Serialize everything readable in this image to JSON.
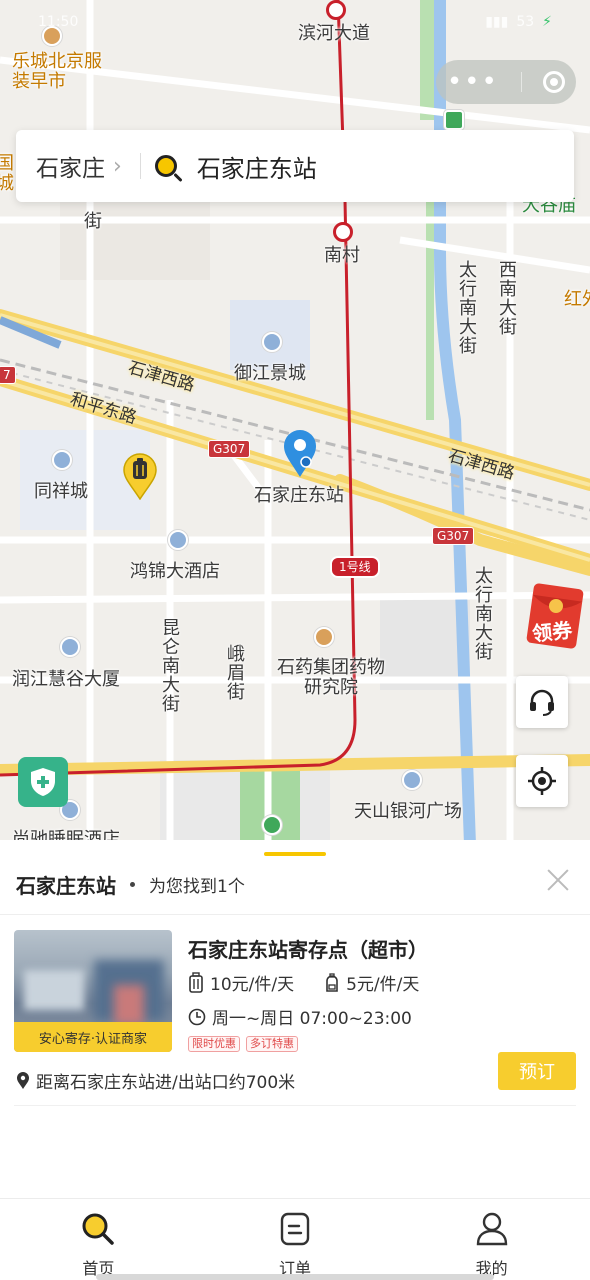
{
  "status_bar": {
    "time": "11:50",
    "battery": "53"
  },
  "search": {
    "city": "石家庄",
    "query": "石家庄东站"
  },
  "map": {
    "labels": {
      "north_street": "滨河大道",
      "top_left_poi": "乐城北京服装早市",
      "left_edge": "国城",
      "street_below_search": "街",
      "nancun": "南村",
      "right_top_poi": "大谷庙",
      "taihang_south": "太行南大街",
      "xinan_street": "西南大街",
      "hong_right": "红外",
      "yujiang": "御江景城",
      "shijin_road_left": "石津西路",
      "heping_road": "和平东路",
      "shijin_road_right": "石津西路",
      "tongxiang": "同祥城",
      "station": "石家庄东站",
      "hongjin": "鸿锦大酒店",
      "kunlun": "昆仑南大街",
      "emei": "峨眉街",
      "shiyao": "石药集团药物研究院",
      "runjiang": "润江慧谷大厦",
      "taihang_south_2": "太行南大街",
      "tianshan": "天山银河广场",
      "bottom_left_poi": "尚驰睡眠酒店",
      "road_g307_a": "G307",
      "road_g307_b": "G307",
      "road_7": "7",
      "line1": "1号线"
    }
  },
  "coupon": {
    "label": "领券"
  },
  "sheet": {
    "title": "石家庄东站",
    "found_text": "为您找到1个",
    "card": {
      "title": "石家庄东站寄存点（超市）",
      "badge": "安心寄存·认证商家",
      "price_large": "10元/件/天",
      "price_small": "5元/件/天",
      "hours": "周一~周日 07:00~23:00",
      "tags": [
        "限时优惠",
        "多订特惠"
      ],
      "book_label": "预订",
      "distance": "距离石家庄东站进/出站口约700米"
    }
  },
  "tabs": [
    {
      "label": "首页",
      "icon": "search-icon"
    },
    {
      "label": "订单",
      "icon": "order-icon"
    },
    {
      "label": "我的",
      "icon": "user-icon"
    }
  ],
  "colors": {
    "accent": "#f7cd2e",
    "metro": "#c8202b",
    "road": "#f6d56a",
    "water": "#9ec5ee",
    "safe": "#36b38a"
  }
}
